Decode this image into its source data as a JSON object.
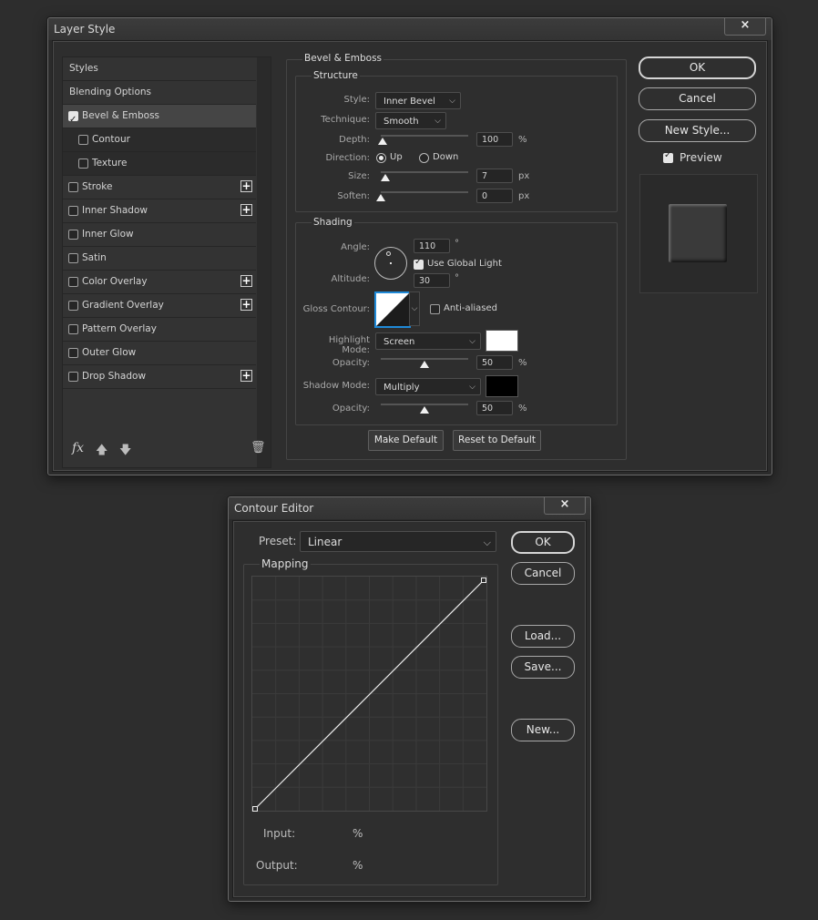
{
  "layer_style": {
    "title": "Layer Style",
    "close_label": "×",
    "style_list": [
      {
        "label": "Styles",
        "checkbox": false,
        "checked": false,
        "plus": false,
        "sub": false,
        "selected": false
      },
      {
        "label": "Blending Options",
        "checkbox": false,
        "checked": false,
        "plus": false,
        "sub": false,
        "selected": false
      },
      {
        "label": "Bevel & Emboss",
        "checkbox": true,
        "checked": true,
        "plus": false,
        "sub": false,
        "selected": true
      },
      {
        "label": "Contour",
        "checkbox": true,
        "checked": false,
        "plus": false,
        "sub": true,
        "selected": false
      },
      {
        "label": "Texture",
        "checkbox": true,
        "checked": false,
        "plus": false,
        "sub": true,
        "selected": false
      },
      {
        "label": "Stroke",
        "checkbox": true,
        "checked": false,
        "plus": true,
        "sub": false,
        "selected": false
      },
      {
        "label": "Inner Shadow",
        "checkbox": true,
        "checked": false,
        "plus": true,
        "sub": false,
        "selected": false
      },
      {
        "label": "Inner Glow",
        "checkbox": true,
        "checked": false,
        "plus": false,
        "sub": false,
        "selected": false
      },
      {
        "label": "Satin",
        "checkbox": true,
        "checked": false,
        "plus": false,
        "sub": false,
        "selected": false
      },
      {
        "label": "Color Overlay",
        "checkbox": true,
        "checked": false,
        "plus": true,
        "sub": false,
        "selected": false
      },
      {
        "label": "Gradient Overlay",
        "checkbox": true,
        "checked": false,
        "plus": true,
        "sub": false,
        "selected": false
      },
      {
        "label": "Pattern Overlay",
        "checkbox": true,
        "checked": false,
        "plus": false,
        "sub": false,
        "selected": false
      },
      {
        "label": "Outer Glow",
        "checkbox": true,
        "checked": false,
        "plus": false,
        "sub": false,
        "selected": false
      },
      {
        "label": "Drop Shadow",
        "checkbox": true,
        "checked": false,
        "plus": true,
        "sub": false,
        "selected": false
      }
    ],
    "footer": {
      "fx": "fx",
      "move_up_icon": "arrow-up-icon",
      "move_down_icon": "arrow-down-icon",
      "delete_icon": "trash-icon"
    },
    "bevel_emboss": {
      "title": "Bevel & Emboss",
      "structure": {
        "title": "Structure",
        "style_label": "Style:",
        "style_value": "Inner Bevel",
        "technique_label": "Technique:",
        "technique_value": "Smooth",
        "depth_label": "Depth:",
        "depth_value": "100",
        "depth_unit": "%",
        "depth_slider": 0.02,
        "direction_label": "Direction:",
        "direction_up": "Up",
        "direction_down": "Down",
        "direction_selected": "Up",
        "size_label": "Size:",
        "size_value": "7",
        "size_unit": "px",
        "size_slider": 0.05,
        "soften_label": "Soften:",
        "soften_value": "0",
        "soften_unit": "px",
        "soften_slider": 0.0
      },
      "shading": {
        "title": "Shading",
        "angle_label": "Angle:",
        "angle_value": "110",
        "angle_unit": "°",
        "use_global_light": "Use Global Light",
        "use_global_light_checked": true,
        "altitude_label": "Altitude:",
        "altitude_value": "30",
        "altitude_unit": "°",
        "gloss_contour_label": "Gloss Contour:",
        "anti_aliased": "Anti-aliased",
        "anti_aliased_checked": false,
        "highlight_mode_label": "Highlight Mode:",
        "highlight_mode_value": "Screen",
        "highlight_color": "#ffffff",
        "highlight_opacity_label": "Opacity:",
        "highlight_opacity_value": "50",
        "highlight_opacity_unit": "%",
        "highlight_opacity_slider": 0.5,
        "shadow_mode_label": "Shadow Mode:",
        "shadow_mode_value": "Multiply",
        "shadow_color": "#000000",
        "shadow_opacity_label": "Opacity:",
        "shadow_opacity_value": "50",
        "shadow_opacity_unit": "%",
        "shadow_opacity_slider": 0.5
      },
      "make_default": "Make Default",
      "reset_to_default": "Reset to Default"
    },
    "buttons": {
      "ok": "OK",
      "cancel": "Cancel",
      "new_style": "New Style..."
    },
    "preview_label": "Preview",
    "preview_checked": true
  },
  "contour_editor": {
    "title": "Contour Editor",
    "close_label": "×",
    "preset_label": "Preset:",
    "preset_value": "Linear",
    "mapping_title": "Mapping",
    "input_label": "Input:",
    "input_unit": "%",
    "output_label": "Output:",
    "output_unit": "%",
    "curve_points": [
      [
        0,
        0
      ],
      [
        100,
        100
      ]
    ],
    "buttons": {
      "ok": "OK",
      "cancel": "Cancel",
      "load": "Load...",
      "save": "Save...",
      "new": "New..."
    }
  }
}
